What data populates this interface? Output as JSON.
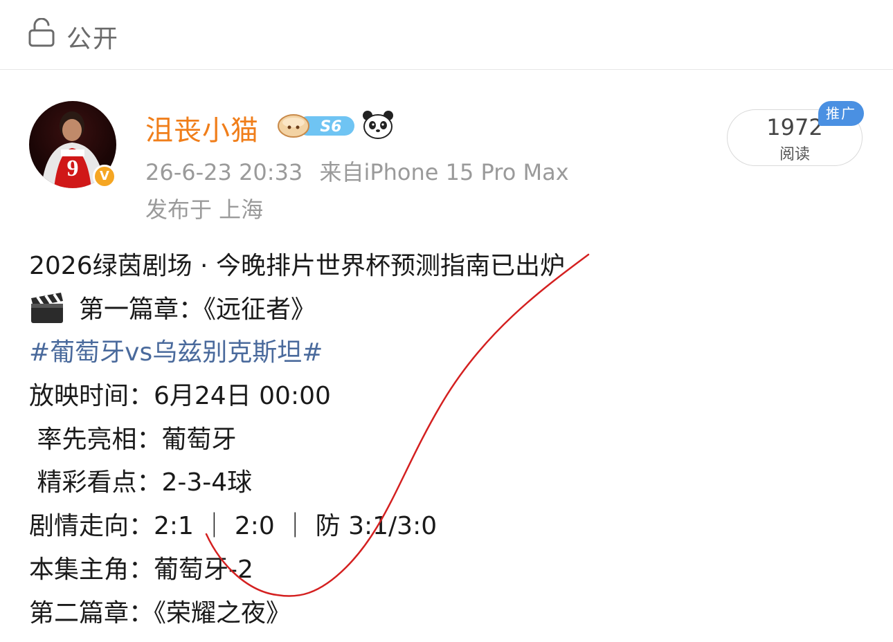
{
  "header": {
    "visibility_label": "公开",
    "lock_icon": "lock-icon"
  },
  "author": {
    "name": "沮丧小猫",
    "level_badge": "S6",
    "verified_mark": "V",
    "panda_icon": "panda-icon",
    "timestamp": "26-6-23 20:33",
    "source": "来自iPhone 15 Pro Max",
    "location": "发布于 上海"
  },
  "stats": {
    "read_count": "1972",
    "read_label": "阅读",
    "promo_tag": "推广"
  },
  "post": {
    "lines": [
      "2026绿茵剧场 · 今晚排片世界杯预测指南已出炉",
      "第一篇章：《远征者》",
      "#葡萄牙vs乌兹别克斯坦#",
      "放映时间：6月24日 00:00",
      " 率先亮相：葡萄牙",
      " 精彩看点：2-3-4球",
      "剧情走向：2:1 ｜ 2:0 ｜ 防 3:1/3:0",
      "本集主角：葡萄牙-2",
      "第二篇章：《荣耀之夜》"
    ],
    "clapper_icon": "clapper-board-icon"
  },
  "colors": {
    "username": "#f07e1a",
    "hashtag": "#4a6a9c",
    "meta": "#9a9a9a",
    "promo": "#4a90e2",
    "scribble": "#d42020",
    "corner": "#f29a2e"
  }
}
